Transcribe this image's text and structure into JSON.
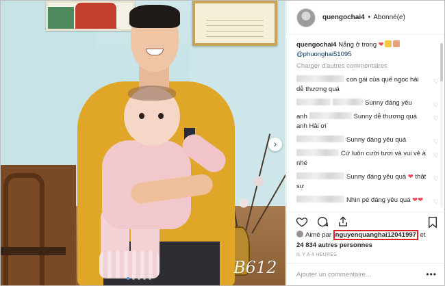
{
  "post": {
    "watermark": "B612",
    "next_arrow": "›"
  },
  "header": {
    "username": "quengochai4",
    "separator": "•",
    "follow_label": "Abonné(e)"
  },
  "caption": {
    "username": "quengochai4",
    "text": "Nắng ở trong",
    "mention": "@phuonghai51095"
  },
  "load_more": "Charger d'autres commentaires",
  "comments": [
    {
      "text": "con gái của quế ngọc hải dễ thương quá"
    },
    {
      "text": "Sunny đáng yêu"
    },
    {
      "prefix": "anh",
      "text": "Sunny dễ thương quá anh Hải ơi"
    },
    {
      "text": "Sunny đáng yêu quá"
    },
    {
      "text": "Cứ luôn cười tươi và vui vẻ à nhé"
    },
    {
      "text": "Sunny đáng yêu quá",
      "suffix": "thật sự"
    },
    {
      "text": "Nhìn pé đáng yêu quá"
    }
  ],
  "likes": {
    "prefix": "Aimé par",
    "liker": "nguyenquanghai12041997",
    "connector": "et",
    "others": "24 834 autres personnes"
  },
  "timestamp": "IL Y A 4 HEURES",
  "add_comment_placeholder": "Ajouter un commentaire...",
  "more_label": "•••",
  "colors": {
    "heart_red": "#ed4956",
    "mention_blue": "#003569",
    "highlight_border": "#e02020",
    "carousel_active": "#3f9bf0"
  },
  "icons": [
    "heart-icon",
    "comment-icon",
    "share-icon",
    "bookmark-icon",
    "next-arrow-icon",
    "more-options-icon"
  ]
}
